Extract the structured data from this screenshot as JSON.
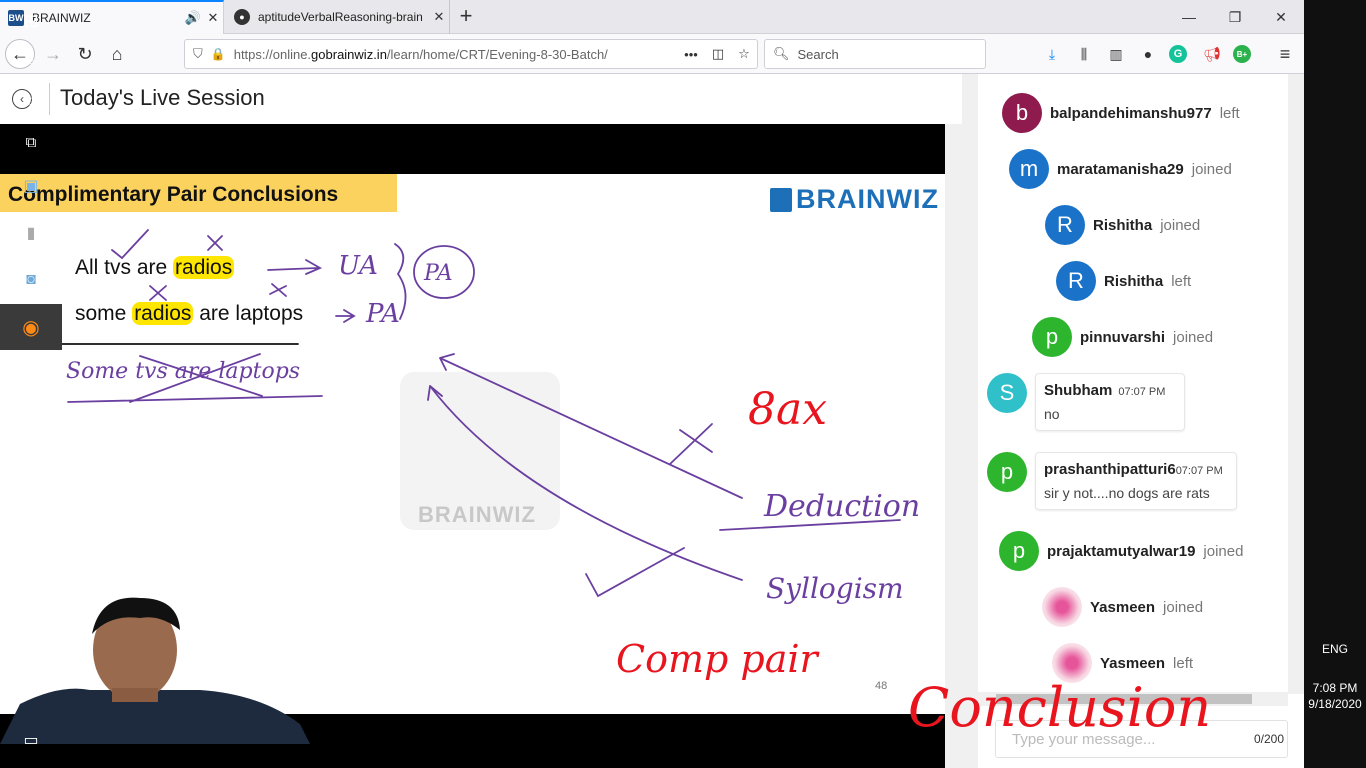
{
  "browser": {
    "tabs": [
      {
        "title": "BRAINWIZ",
        "favicon": "BW",
        "audio_icon": "speaker-icon",
        "close": "✕"
      },
      {
        "title": "aptitudeVerbalReasoning-brain",
        "favicon": "github-icon",
        "close": "✕"
      }
    ],
    "new_tab": "+",
    "url_prefix": "https://online.",
    "url_domain": "gobrainwiz.in",
    "url_path": "/learn/home/CRT/Evening-8-30-Batch/",
    "url_more": "•••",
    "search_placeholder": "Search",
    "window_controls": [
      "—",
      "❐",
      "✕"
    ],
    "ext_badge_g": "G",
    "ext_badge_b": "B+"
  },
  "page": {
    "title": "Today's Live Session"
  },
  "slide": {
    "title": "Complimentary Pair Conclusions",
    "logo": "BRAINWIZ",
    "line1_pre": "All tvs are ",
    "line1_hl": "radios",
    "line2_pre": "some ",
    "line2_hl": "radios",
    "line2_post": " are laptops",
    "slide_number": "48",
    "watermark": "BRAINWIZ",
    "annotations": {
      "ua": "UA",
      "pa1": "PA",
      "pa2": "PA",
      "conclusion": "Some tvs are laptops",
      "eight_ax": "8ax",
      "deduction": "Deduction",
      "syllogism": "Syllogism",
      "comp_pair": "Comp pair",
      "conclusion_red": "Conclusion"
    },
    "ink_colors": {
      "purple": "#6a3fa0",
      "red": "#e8141e"
    }
  },
  "chat": {
    "messages": [
      {
        "type": "event",
        "initial": "b",
        "name": "balpandehimanshu977",
        "action": "left",
        "color": "#8e1a4e"
      },
      {
        "type": "event",
        "initial": "m",
        "name": "maratamanisha29",
        "action": "joined",
        "color": "#1a73c9"
      },
      {
        "type": "event",
        "initial": "R",
        "name": "Rishitha",
        "action": "joined",
        "color": "#1a73c9"
      },
      {
        "type": "event",
        "initial": "R",
        "name": "Rishitha",
        "action": "left",
        "color": "#1a73c9"
      },
      {
        "type": "event",
        "initial": "p",
        "name": "pinnuvarshi",
        "action": "joined",
        "color": "#2db52d"
      },
      {
        "type": "text",
        "initial": "S",
        "name": "Shubham",
        "time": "07:07 PM",
        "text": "no",
        "color": "#2fc0c9"
      },
      {
        "type": "text",
        "initial": "p",
        "name": "prashanthipatturi6",
        "time": "07:07 PM",
        "text": "sir y not....no dogs are rats",
        "color": "#2db52d"
      },
      {
        "type": "event",
        "initial": "p",
        "name": "prajaktamutyalwar19",
        "action": "joined",
        "color": "#2db52d"
      },
      {
        "type": "event",
        "initial": "",
        "name": "Yasmeen",
        "action": "joined",
        "color": "#f3c6d6"
      },
      {
        "type": "event",
        "initial": "",
        "name": "Yasmeen",
        "action": "left",
        "color": "#f3c6d6"
      }
    ],
    "input_placeholder": "Type your message...",
    "char_count": "0/200"
  },
  "taskbar": {
    "language": "ENG",
    "time": "7:08 PM",
    "date": "9/18/2020"
  }
}
